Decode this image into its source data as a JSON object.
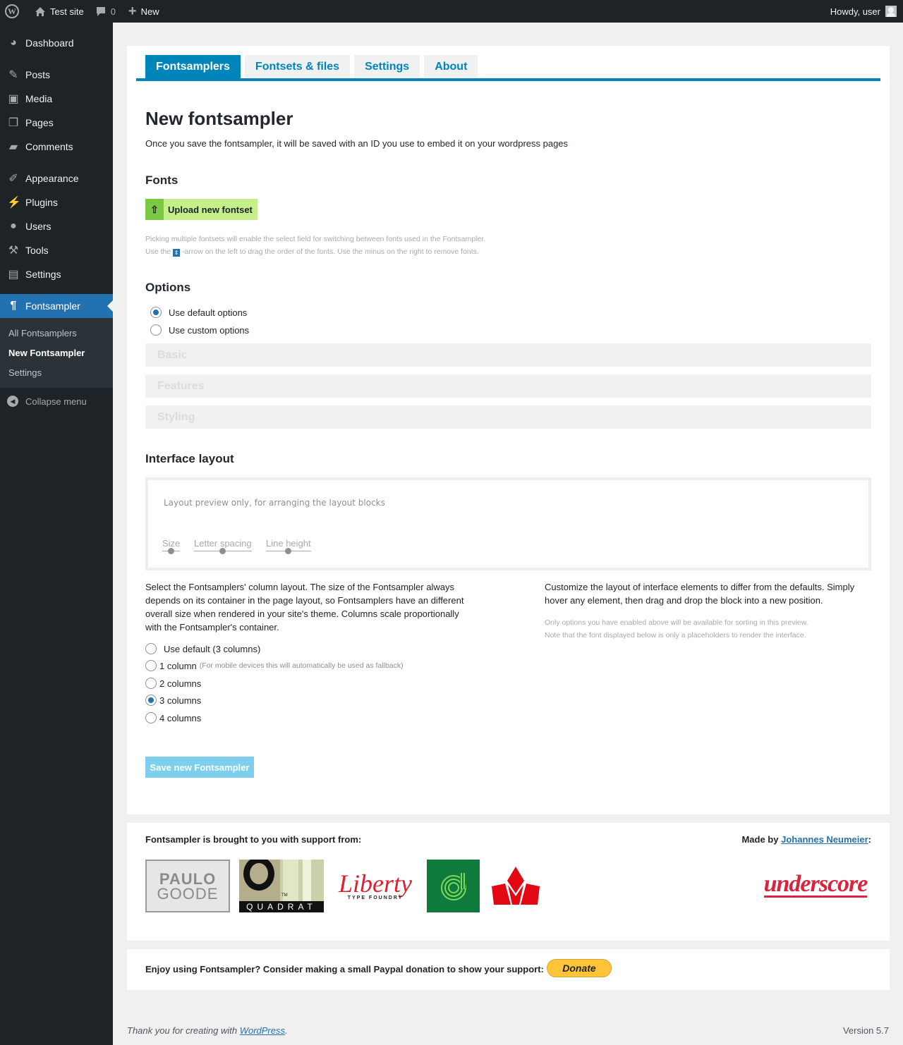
{
  "adminbar": {
    "site_name": "Test site",
    "comments_count": "0",
    "new_label": "New",
    "howdy": "Howdy, user"
  },
  "sidebar": {
    "items": [
      {
        "label": "Dashboard",
        "icon": "dashboard-icon"
      },
      {
        "label": "Posts",
        "icon": "pin-icon"
      },
      {
        "label": "Media",
        "icon": "media-icon"
      },
      {
        "label": "Pages",
        "icon": "pages-icon"
      },
      {
        "label": "Comments",
        "icon": "comment-icon"
      },
      {
        "label": "Appearance",
        "icon": "brush-icon"
      },
      {
        "label": "Plugins",
        "icon": "plug-icon"
      },
      {
        "label": "Users",
        "icon": "user-icon"
      },
      {
        "label": "Tools",
        "icon": "wrench-icon"
      },
      {
        "label": "Settings",
        "icon": "settings-icon"
      },
      {
        "label": "Fontsampler",
        "icon": "pilcrow-icon"
      }
    ],
    "submenu": [
      "All Fontsamplers",
      "New Fontsampler",
      "Settings"
    ],
    "collapse_label": "Collapse menu"
  },
  "tabs": [
    "Fontsamplers",
    "Fontsets & files",
    "Settings",
    "About"
  ],
  "main": {
    "title": "New fontsampler",
    "intro": "Once you save the fontsampler, it will be saved with an ID you use to embed it on your wordpress pages",
    "fonts_heading": "Fonts",
    "upload_label": "Upload new fontset",
    "fonts_hint_1": "Picking multiple fontsets will enable the select field for switching between fonts used in the Fontsampler.",
    "fonts_hint_2a": "Use the",
    "fonts_hint_2b": "-arrow on the left to drag the order of the fonts. Use the minus on the right to remove fonts.",
    "options_heading": "Options",
    "option_default": "Use default options",
    "option_custom": "Use custom options",
    "accordions": [
      "Basic",
      "Features",
      "Styling"
    ],
    "layout_heading": "Interface layout",
    "layout_preview_text": "Layout preview only, for arranging the layout blocks",
    "sliders": [
      "Size",
      "Letter spacing",
      "Line height"
    ],
    "columns_text": "Select the Fontsamplers' column layout. The size of the Fontsampler always depends on its container in the page layout, so Fontsamplers have an different overall size when rendered in your site's theme. Columns scale proportionally with the Fontsampler's container.",
    "columns": {
      "default": "Use default (3 columns)",
      "one": "1 column",
      "one_note": "(For mobile devices this will automatically be used as fallback)",
      "two": "2 columns",
      "three": "3 columns",
      "four": "4 columns",
      "selected": "3 columns"
    },
    "customize_text": "Customize the layout of interface elements to differ from the defaults. Simply hover any element, then drag and drop the block into a new position.",
    "customize_note_1": "Only options you have enabled above will be available for sorting in this preview.",
    "customize_note_2": "Note that the font displayed below is only a placeholders to render the interface.",
    "save_label": "Save new Fontsampler"
  },
  "support": {
    "title": "Fontsampler is brought to you with support from:",
    "made_by": "Made by",
    "author": "Johannes Neumeier",
    "logos": {
      "paulo_line1": "PAULO",
      "paulo_line2": "GOODE",
      "quadrat_tm": "TM",
      "quadrat_text": "QUADRAT",
      "liberty_script": "Liberty",
      "liberty_sub": "TYPE FOUNDRY",
      "underscore": "underscore"
    }
  },
  "donate": {
    "text": "Enjoy using Fontsampler? Consider making a small Paypal donation to show your support:",
    "button": "Donate"
  },
  "footer": {
    "thanks_prefix": "Thank you for creating with",
    "wordpress": "WordPress",
    "version": "Version 5.7"
  }
}
